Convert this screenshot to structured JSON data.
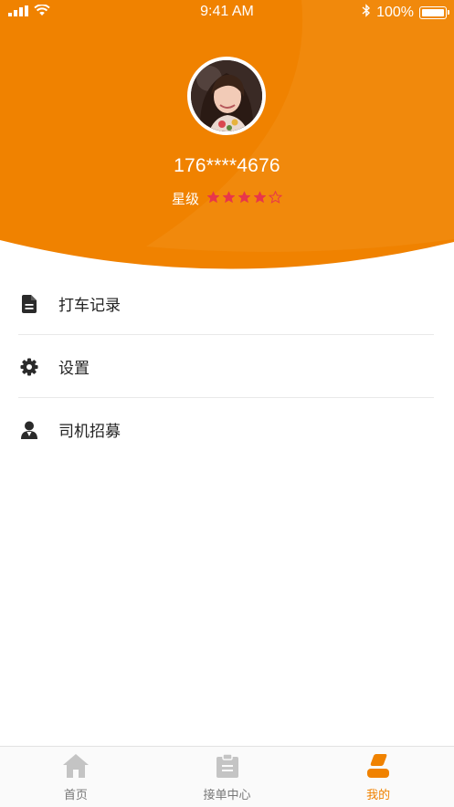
{
  "status_bar": {
    "time": "9:41 AM",
    "battery": "100%"
  },
  "profile": {
    "phone": "176****4676",
    "rating_label": "星级",
    "rating": 4,
    "rating_max": 5
  },
  "menu": [
    {
      "label": "打车记录",
      "icon": "document-icon"
    },
    {
      "label": "设置",
      "icon": "gear-icon"
    },
    {
      "label": "司机招募",
      "icon": "person-icon"
    }
  ],
  "tabs": [
    {
      "label": "首页",
      "icon": "home-icon",
      "active": false
    },
    {
      "label": "接单中心",
      "icon": "clipboard-icon",
      "active": false
    },
    {
      "label": "我的",
      "icon": "user-icon",
      "active": true
    }
  ],
  "colors": {
    "accent": "#F08200",
    "star": "#E8364B",
    "inactive": "#777777"
  }
}
